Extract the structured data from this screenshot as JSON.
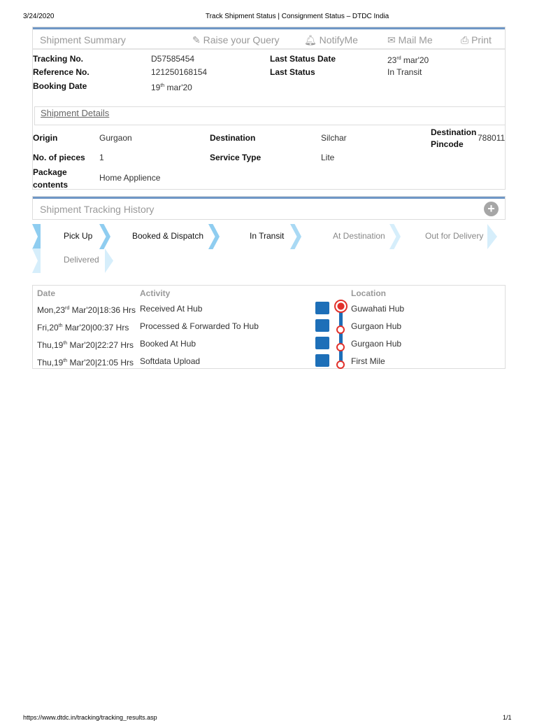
{
  "print_header": {
    "date": "3/24/2020",
    "title": "Track Shipment Status | Consignment Status – DTDC India"
  },
  "print_footer": {
    "url": "https://www.dtdc.in/tracking/tracking_results.asp",
    "page": "1/1"
  },
  "summary": {
    "title": "Shipment Summary",
    "actions": {
      "query": "Raise your Query",
      "notify": "NotifyMe",
      "mail": "Mail Me",
      "print": "Print"
    },
    "tracking_label": "Tracking No.",
    "tracking_value": "D57585454",
    "reference_label": "Reference No.",
    "reference_value": "121250168154",
    "booking_label": "Booking Date",
    "booking_day": "19",
    "booking_sup": "th",
    "booking_rest": " mar'20",
    "last_date_label": "Last Status Date",
    "last_date_day": "23",
    "last_date_sup": "rd",
    "last_date_rest": " mar'20",
    "last_status_label": "Last Status",
    "last_status_value": "In Transit"
  },
  "details": {
    "title": "Shipment Details",
    "origin_label": "Origin",
    "origin": "Gurgaon",
    "destination_label": "Destination",
    "destination": "Silchar",
    "pincode_label": "Destination Pincode",
    "pincode": "788011",
    "pieces_label": "No. of pieces",
    "pieces": "1",
    "service_label": "Service Type",
    "service": "Lite",
    "contents_label": "Package contents",
    "contents": "Home Applience"
  },
  "history": {
    "title": "Shipment Tracking History",
    "steps": [
      "Pick Up",
      "Booked & Dispatch",
      "In Transit",
      "At Destination",
      "Out for Delivery",
      "Delivered"
    ],
    "headers": {
      "date": "Date",
      "activity": "Activity",
      "location": "Location"
    },
    "rows": [
      {
        "date_pre": "Mon,23",
        "sup": "rd",
        "date_post": " Mar'20|18:36 Hrs",
        "activity": "Received At Hub",
        "location": "Guwahati Hub"
      },
      {
        "date_pre": "Fri,20",
        "sup": "th",
        "date_post": " Mar'20|00:37 Hrs",
        "activity": "Processed & Forwarded To Hub",
        "location": "Gurgaon Hub"
      },
      {
        "date_pre": "Thu,19",
        "sup": "th",
        "date_post": " Mar'20|22:27 Hrs",
        "activity": "Booked At Hub",
        "location": "Gurgaon Hub"
      },
      {
        "date_pre": "Thu,19",
        "sup": "th",
        "date_post": " Mar'20|21:05 Hrs",
        "activity": "Softdata Upload",
        "location": "First Mile"
      }
    ]
  },
  "colors": {
    "accent": "#6f97c6",
    "step": "#8fcdf0",
    "current": "#e2312b",
    "track": "#1d6fb8"
  }
}
